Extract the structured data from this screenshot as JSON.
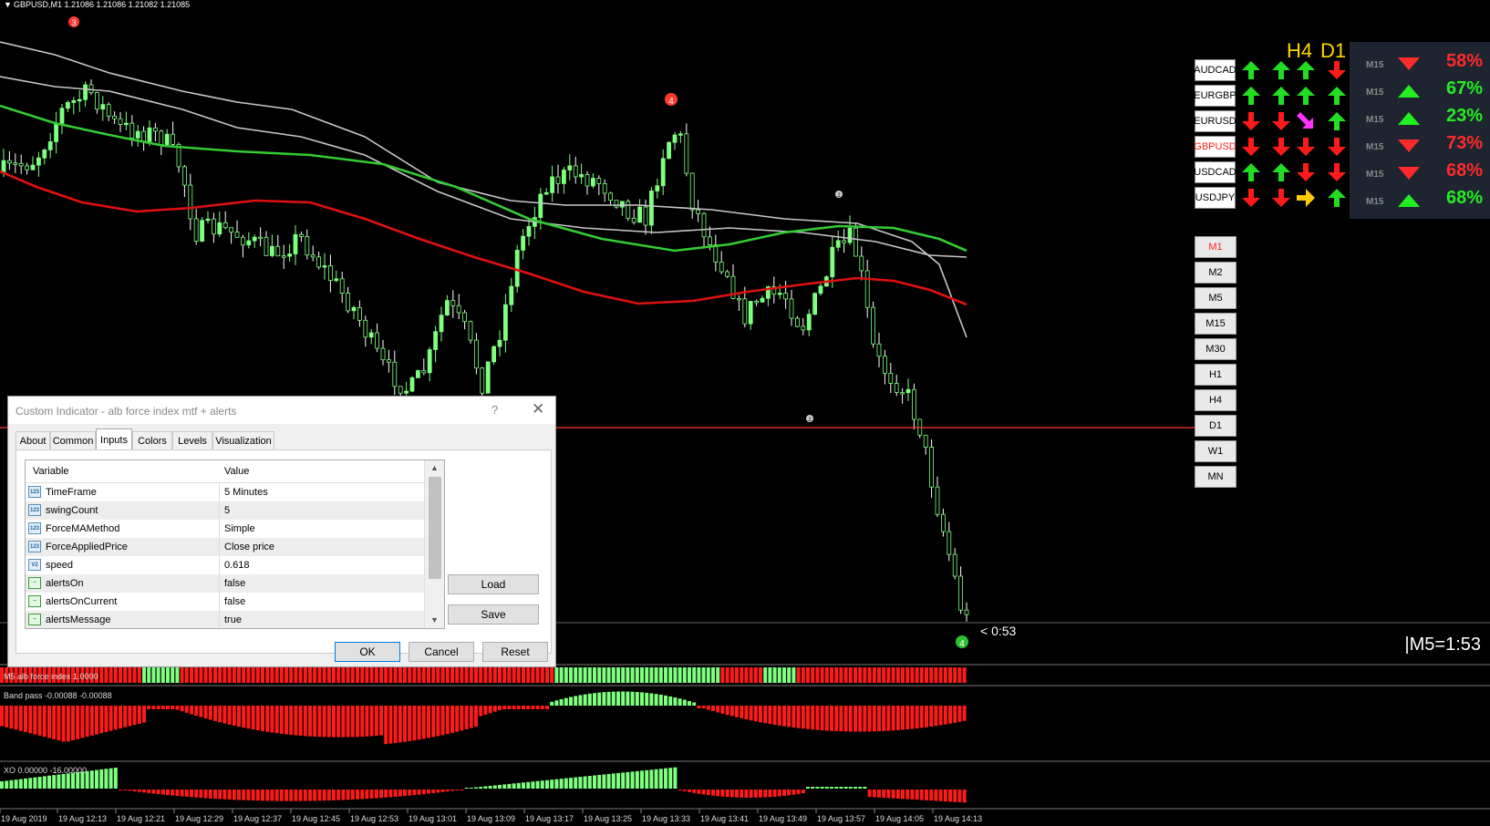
{
  "chart_header": "GBPUSD,M1  1.21086 1.21086 1.21082 1.21085",
  "swing_labels": {
    "top_left": "3",
    "top_mid": "4",
    "right_small_top": "2",
    "right_small_bottom": "2",
    "bottom": "4"
  },
  "price_label": "< 0:53",
  "m5_timer": "|M5=1:53",
  "indicator_labels": {
    "force": "M5 alb force index 1.0000",
    "bandpass": "Band pass  -0.00088 -0.00088",
    "xo": "XO 0.00000 -16.00000"
  },
  "time_axis": [
    "19 Aug 2019",
    "19 Aug 12:13",
    "19 Aug 12:21",
    "19 Aug 12:29",
    "19 Aug 12:37",
    "19 Aug 12:45",
    "19 Aug 12:53",
    "19 Aug 13:01",
    "19 Aug 13:09",
    "19 Aug 13:17",
    "19 Aug 13:25",
    "19 Aug 13:33",
    "19 Aug 13:41",
    "19 Aug 13:49",
    "19 Aug 13:57",
    "19 Aug 14:05",
    "19 Aug 14:13"
  ],
  "dashboard": {
    "headers": [
      "H4",
      "D1"
    ],
    "symbols": [
      {
        "name": "AUDCAD",
        "color": "#000000",
        "arrows": [
          "up",
          "up",
          "up",
          "down"
        ],
        "m15_label": "M15",
        "pct": "58%",
        "dir": "down",
        "pct_color": "#ff2a2a"
      },
      {
        "name": "EURGBP",
        "color": "#000000",
        "arrows": [
          "up",
          "up",
          "up",
          "up"
        ],
        "m15_label": "M15",
        "pct": "67%",
        "dir": "up",
        "pct_color": "#22ee22"
      },
      {
        "name": "EURUSD",
        "color": "#000000",
        "arrows": [
          "down",
          "down",
          "magenta-down-right",
          "up"
        ],
        "m15_label": "M15",
        "pct": "23%",
        "dir": "up",
        "pct_color": "#22ee22"
      },
      {
        "name": "GBPUSD",
        "color": "#ff2020",
        "arrows": [
          "down",
          "down",
          "down",
          "down"
        ],
        "m15_label": "M15",
        "pct": "73%",
        "dir": "down",
        "pct_color": "#ff2a2a"
      },
      {
        "name": "USDCAD",
        "color": "#000000",
        "arrows": [
          "up",
          "up",
          "down",
          "down"
        ],
        "m15_label": "M15",
        "pct": "68%",
        "dir": "down",
        "pct_color": "#ff2a2a"
      },
      {
        "name": "USDJPY",
        "color": "#000000",
        "arrows": [
          "down",
          "down",
          "yellow-right",
          "up"
        ],
        "m15_label": "M15",
        "pct": "68%",
        "dir": "up",
        "pct_color": "#22ee22"
      }
    ],
    "timeframes": [
      {
        "label": "M1",
        "active": true
      },
      {
        "label": "M2",
        "active": false
      },
      {
        "label": "M5",
        "active": false
      },
      {
        "label": "M15",
        "active": false
      },
      {
        "label": "M30",
        "active": false
      },
      {
        "label": "H1",
        "active": false
      },
      {
        "label": "H4",
        "active": false
      },
      {
        "label": "D1",
        "active": false
      },
      {
        "label": "W1",
        "active": false
      },
      {
        "label": "MN",
        "active": false
      }
    ]
  },
  "dialog": {
    "title": "Custom Indicator - alb force index mtf + alerts",
    "help": "?",
    "tabs": [
      "About",
      "Common",
      "Inputs",
      "Colors",
      "Levels",
      "Visualization"
    ],
    "active_tab": "Inputs",
    "columns": [
      "Variable",
      "Value"
    ],
    "rows": [
      {
        "icon": "123",
        "variable": "TimeFrame",
        "value": "5 Minutes"
      },
      {
        "icon": "123",
        "variable": "swingCount",
        "value": "5"
      },
      {
        "icon": "123",
        "variable": "ForceMAMethod",
        "value": "Simple"
      },
      {
        "icon": "123",
        "variable": "ForceAppliedPrice",
        "value": "Close price"
      },
      {
        "icon": "V2",
        "variable": "speed",
        "value": "0.618"
      },
      {
        "icon": "bool",
        "variable": "alertsOn",
        "value": "false"
      },
      {
        "icon": "bool",
        "variable": "alertsOnCurrent",
        "value": "false"
      },
      {
        "icon": "bool",
        "variable": "alertsMessage",
        "value": "true"
      }
    ],
    "load": "Load",
    "save": "Save",
    "ok": "OK",
    "cancel": "Cancel",
    "reset": "Reset"
  },
  "colors": {
    "bull": "#7fff7f",
    "bear": "#ff1a1a",
    "ma_green": "#33cc33",
    "ma_red": "#e01010",
    "ma_gray": "#c8c8c8"
  }
}
